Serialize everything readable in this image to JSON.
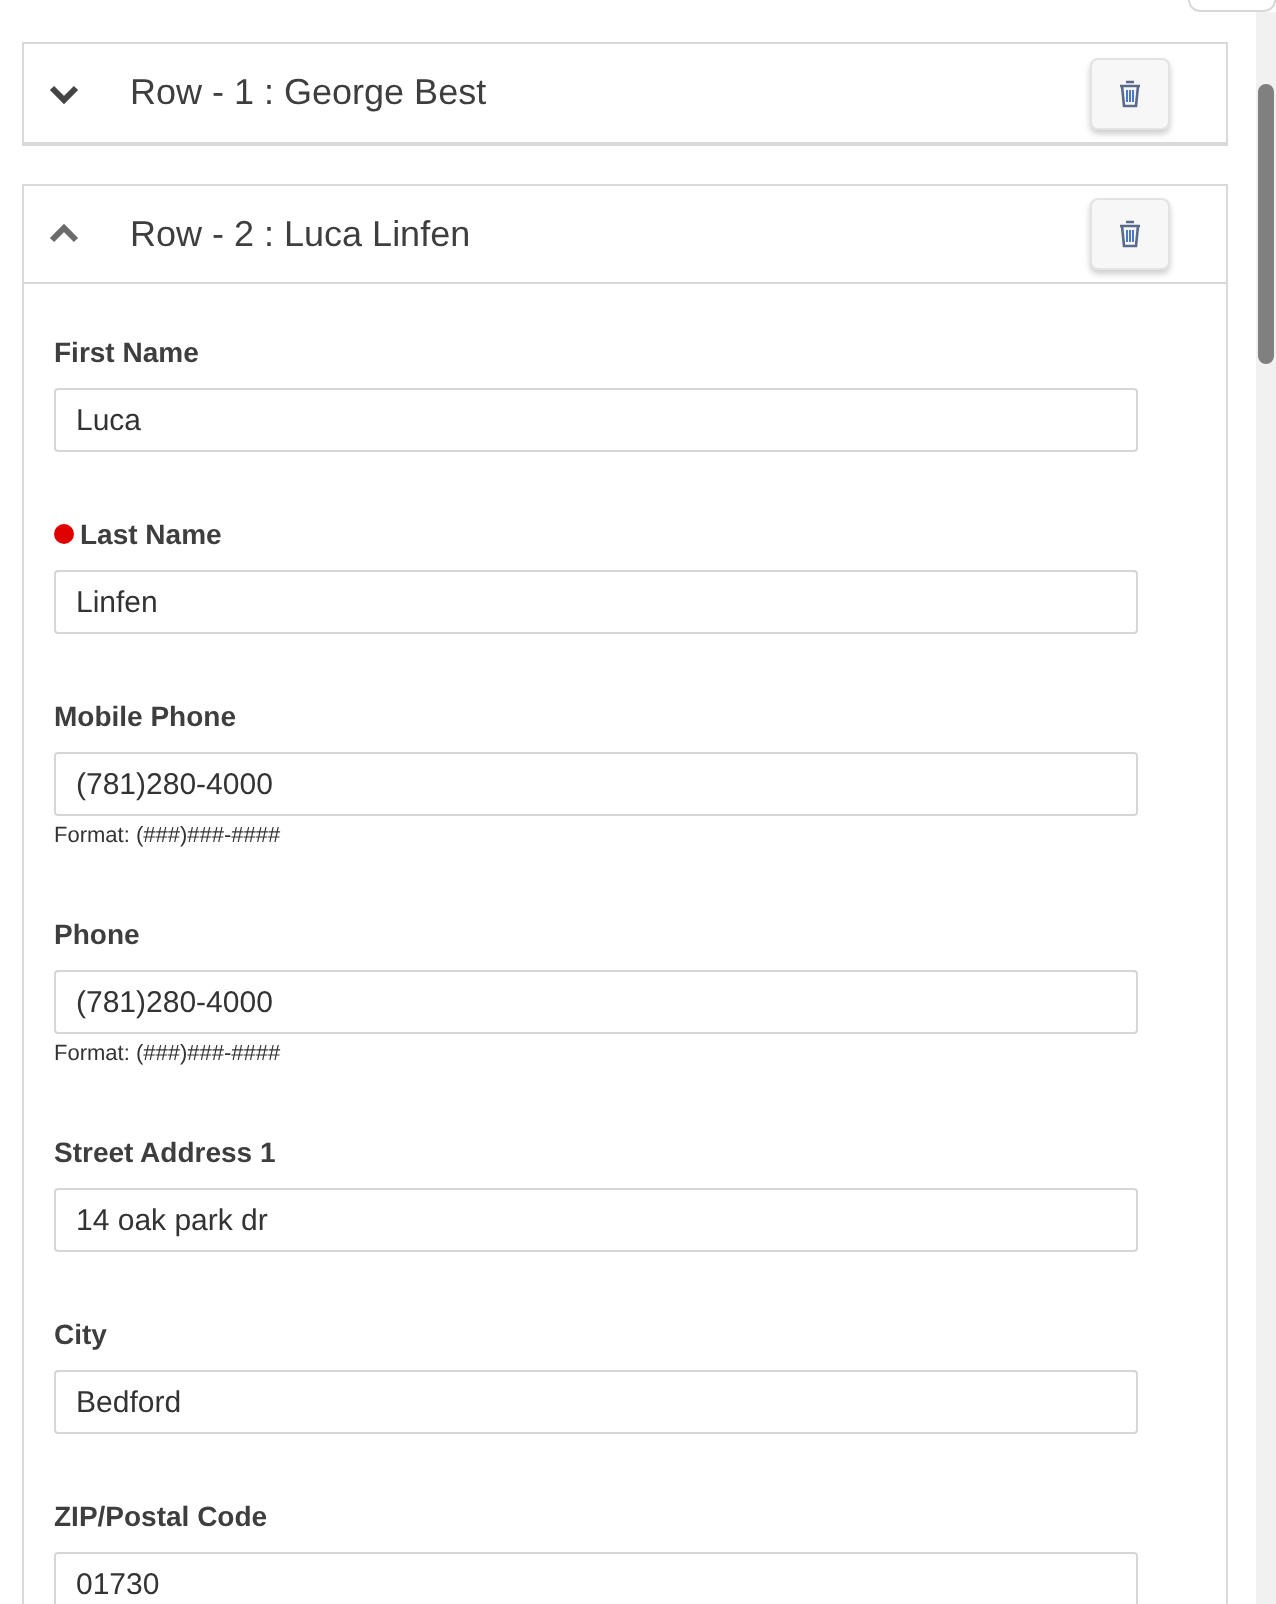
{
  "rows": [
    {
      "title": "Row - 1 : George Best",
      "expanded": false,
      "fields": []
    },
    {
      "title": "Row - 2 : Luca Linfen",
      "expanded": true,
      "fields": [
        {
          "label": "First Name",
          "value": "Luca",
          "required": false
        },
        {
          "label": "Last Name",
          "value": "Linfen",
          "required": true
        },
        {
          "label": "Mobile Phone",
          "value": "(781)280-4000",
          "required": false,
          "hint": "Format: (###)###-####"
        },
        {
          "label": "Phone",
          "value": "(781)280-4000",
          "required": false,
          "hint": "Format: (###)###-####"
        },
        {
          "label": "Street Address 1",
          "value": "14 oak park dr",
          "required": false
        },
        {
          "label": "City",
          "value": "Bedford",
          "required": false
        },
        {
          "label": "ZIP/Postal Code",
          "value": "01730",
          "required": false
        }
      ]
    }
  ]
}
